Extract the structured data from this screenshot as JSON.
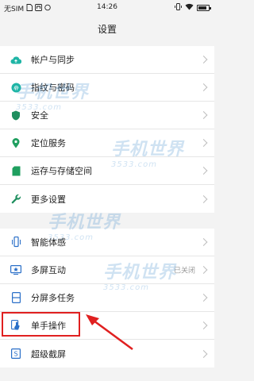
{
  "status_bar": {
    "carrier": "无SIM",
    "time": "14:26"
  },
  "title": "设置",
  "groups": [
    {
      "items": [
        {
          "label": "帐户与同步",
          "icon": "cloud-icon",
          "color": "#1fb5a6"
        },
        {
          "label": "指纹与密码",
          "icon": "fingerprint-icon",
          "color": "#1fb5a6"
        },
        {
          "label": "安全",
          "icon": "shield-icon",
          "color": "#1f8f5f"
        },
        {
          "label": "定位服务",
          "icon": "location-pin-icon",
          "color": "#1f9f5f"
        },
        {
          "label": "运存与存储空间",
          "icon": "sd-card-icon",
          "color": "#1f9f5f"
        },
        {
          "label": "更多设置",
          "icon": "wrench-icon",
          "color": "#1f8f5f"
        }
      ]
    },
    {
      "items": [
        {
          "label": "智能体感",
          "icon": "phone-motion-icon",
          "color": "#2a6fc8"
        },
        {
          "label": "多屏互动",
          "icon": "multi-screen-icon",
          "color": "#2a6fc8",
          "value": "已关闭"
        },
        {
          "label": "分屏多任务",
          "icon": "split-screen-icon",
          "color": "#2a6fc8"
        },
        {
          "label": "单手操作",
          "icon": "hand-touch-icon",
          "color": "#2a6fc8"
        },
        {
          "label": "超级截屏",
          "icon": "screenshot-icon",
          "color": "#2a6fc8"
        }
      ]
    }
  ],
  "watermark": {
    "main": "手机世界",
    "sub": "3533.com"
  },
  "annotation": {
    "highlight_color": "#e02020"
  }
}
